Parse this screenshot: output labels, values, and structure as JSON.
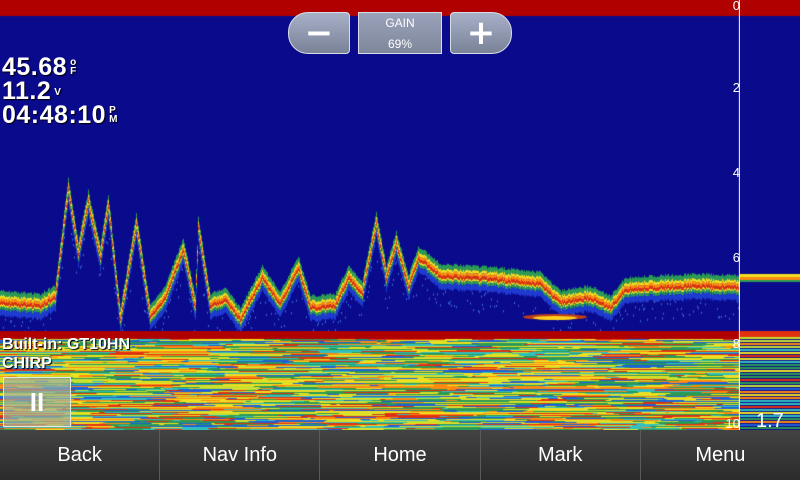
{
  "gain": {
    "label": "GAIN",
    "value": "69%",
    "minus_symbol": "−",
    "plus_symbol": "+"
  },
  "readouts": {
    "temperature": {
      "value": "45.68",
      "unit_top": "o",
      "unit_bottom": "F"
    },
    "voltage": {
      "value": "11.2",
      "unit": "V"
    },
    "time": {
      "value": "04:48:10",
      "unit_top": "P",
      "unit_bottom": "M"
    }
  },
  "source": {
    "transducer": "Built-in: GT10HN",
    "mode": "CHIRP"
  },
  "pause_symbol": "II",
  "depth_scale": {
    "ticks": [
      "0",
      "2",
      "4",
      "6",
      "8",
      "10"
    ],
    "current_depth": "1.7"
  },
  "nav": {
    "buttons": [
      "Back",
      "Nav Info",
      "Home",
      "Mark",
      "Menu"
    ]
  },
  "colors": {
    "water": "#0a0a8c",
    "surface_band": "#b00000",
    "navbar": "#333333",
    "gain_button": "#8a92aa"
  }
}
